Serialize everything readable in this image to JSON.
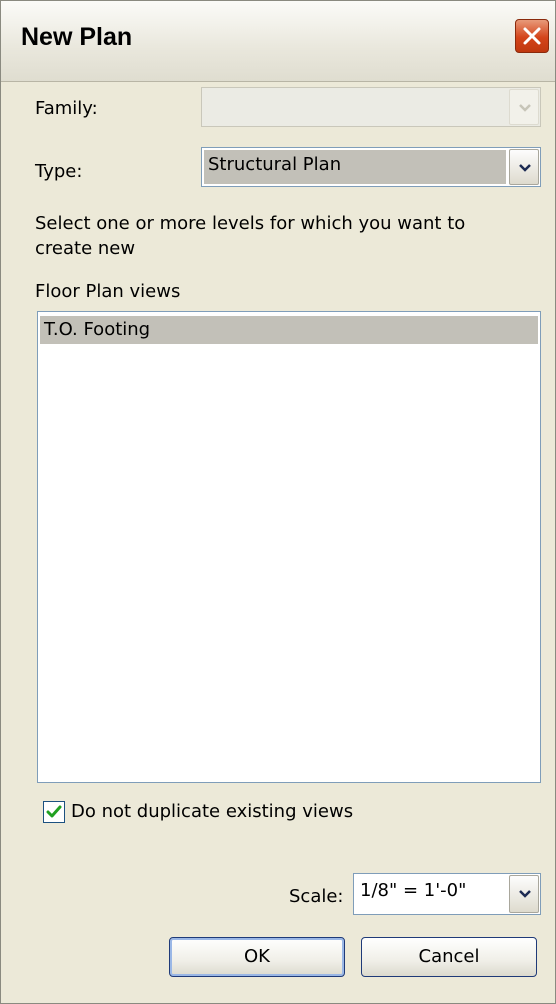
{
  "window": {
    "title": "New Plan"
  },
  "family": {
    "label": "Family:",
    "value": ""
  },
  "type": {
    "label": "Type:",
    "value": "Structural Plan"
  },
  "prompt": "Select one or more levels for which you want to create new",
  "list_heading": "Floor Plan views",
  "levels": [
    {
      "label": "T.O. Footing",
      "selected": true
    }
  ],
  "duplicate_option": {
    "label": "Do not duplicate existing views",
    "checked": true
  },
  "scale": {
    "label": "Scale:",
    "value": "1/8\" = 1'-0\""
  },
  "buttons": {
    "ok": "OK",
    "cancel": "Cancel"
  },
  "colors": {
    "dialog_bg": "#ece9d8",
    "selection": "#c2c0b8",
    "close_red": "#d4441a",
    "check_green": "#21a121",
    "field_border": "#7f9db9"
  }
}
